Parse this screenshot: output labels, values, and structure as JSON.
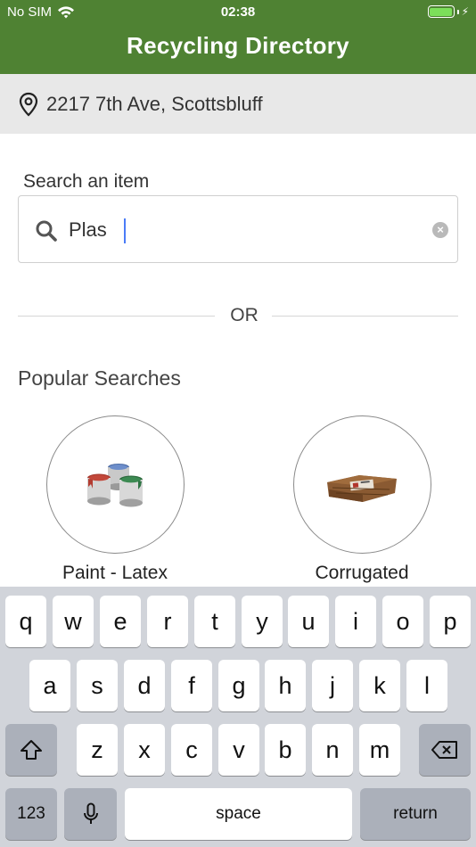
{
  "status_bar": {
    "carrier": "No SIM",
    "time": "02:38"
  },
  "header": {
    "title": "Recycling Directory"
  },
  "location": {
    "address": "2217 7th Ave, Scottsbluff"
  },
  "search": {
    "label": "Search an item",
    "value": "Plas"
  },
  "divider": {
    "text": "OR"
  },
  "popular": {
    "heading": "Popular Searches",
    "items": [
      {
        "label": "Paint - Latex"
      },
      {
        "label": "Corrugated"
      }
    ]
  },
  "keyboard": {
    "row1": [
      "q",
      "w",
      "e",
      "r",
      "t",
      "y",
      "u",
      "i",
      "o",
      "p"
    ],
    "row2": [
      "a",
      "s",
      "d",
      "f",
      "g",
      "h",
      "j",
      "k",
      "l"
    ],
    "row3": [
      "z",
      "x",
      "c",
      "v",
      "b",
      "n",
      "m"
    ],
    "numbers_label": "123",
    "space_label": "space",
    "return_label": "return"
  },
  "colors": {
    "header": "#4f8233",
    "battery": "#7cdf5a",
    "keyboard_bg": "#d1d4da"
  }
}
